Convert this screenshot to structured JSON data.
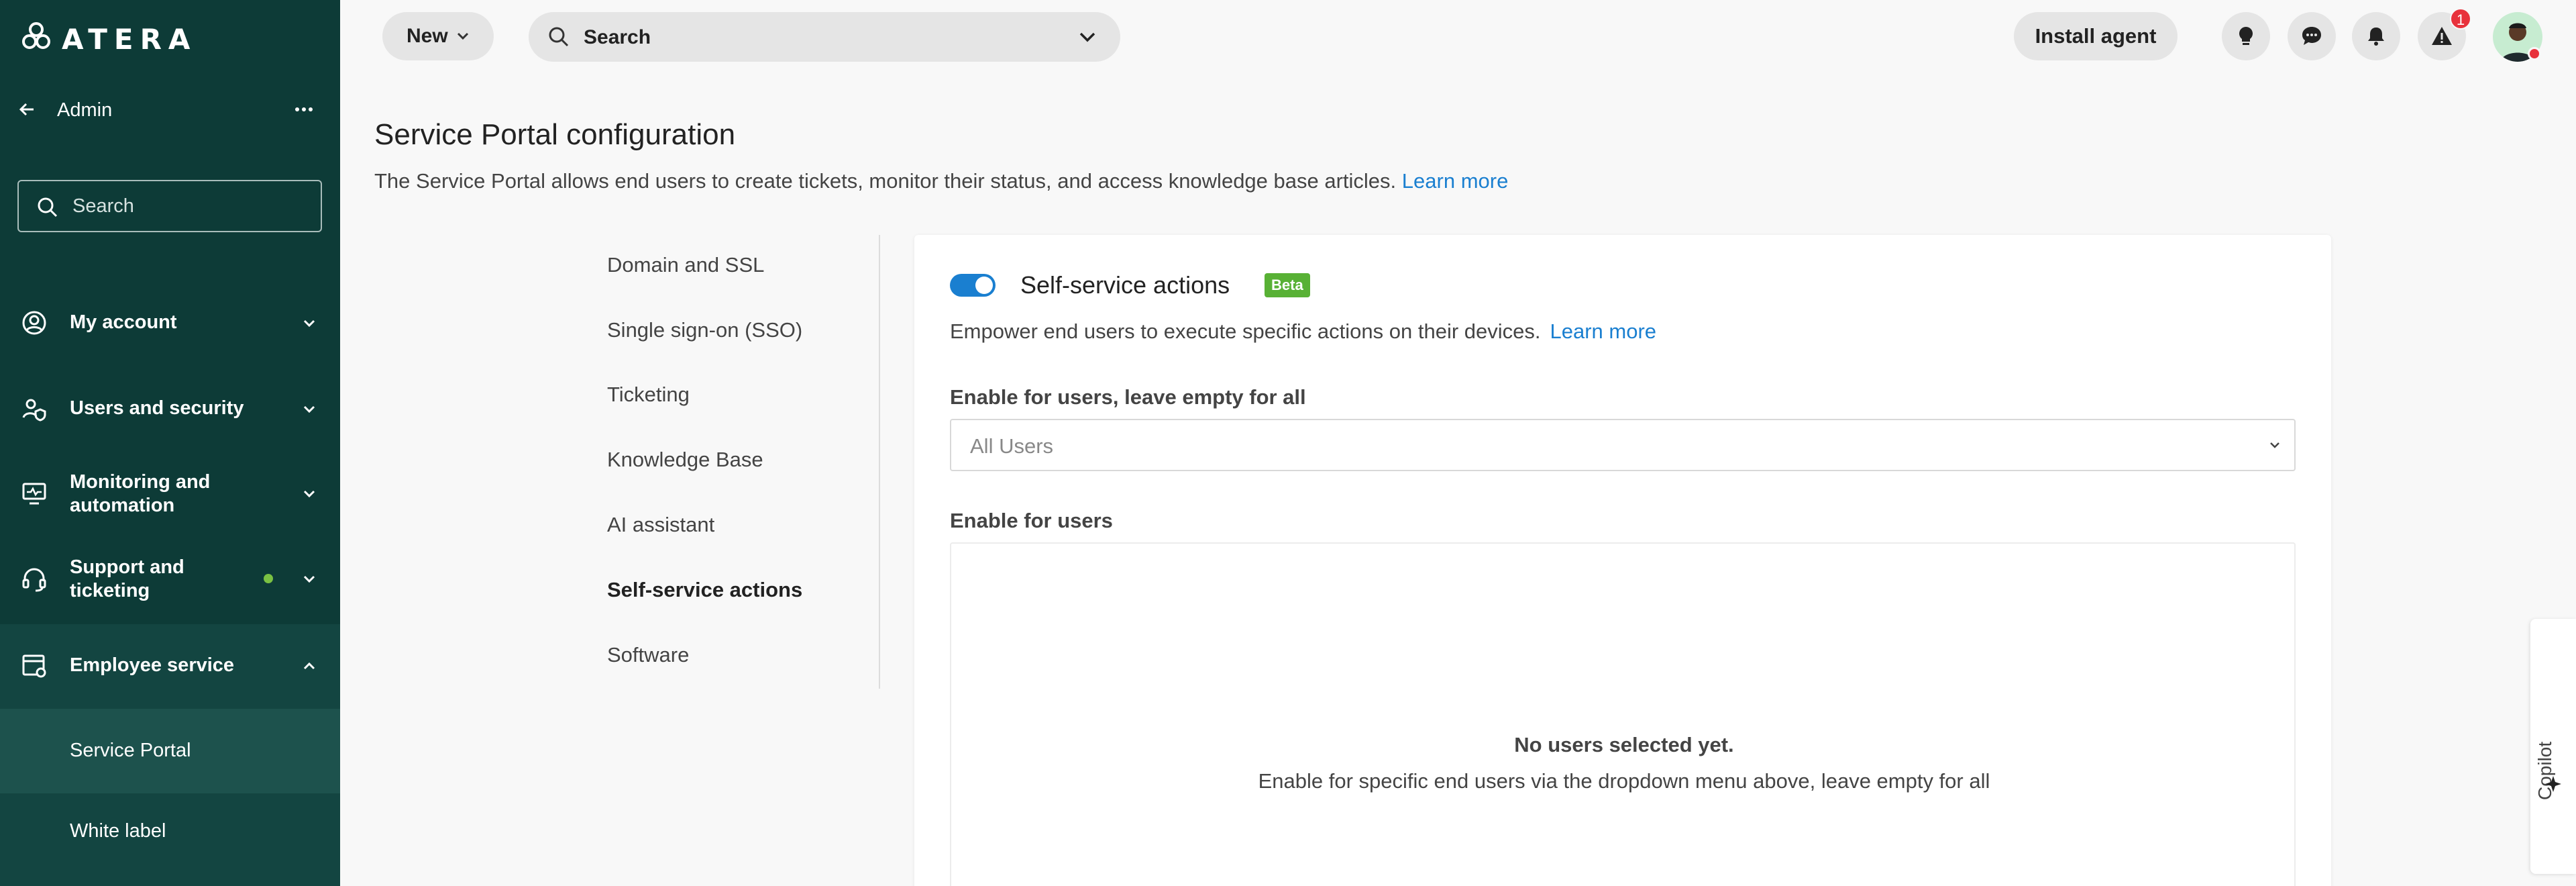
{
  "app": {
    "brand": "ATERA"
  },
  "sidebar": {
    "header_title": "Admin",
    "search_placeholder": "Search",
    "items": [
      {
        "label": "My account",
        "icon": "user-circle-icon"
      },
      {
        "label": "Users and security",
        "icon": "users-shield-icon"
      },
      {
        "label": "Monitoring and automation",
        "icon": "monitor-pulse-icon"
      },
      {
        "label": "Support and ticketing",
        "icon": "headset-icon",
        "status_dot_color": "#7ac143"
      },
      {
        "label": "Employee service",
        "icon": "portal-icon",
        "expanded": true
      }
    ],
    "sub_items": [
      {
        "label": "Service Portal",
        "active": true
      },
      {
        "label": "White label",
        "active": false
      }
    ]
  },
  "topbar": {
    "new_label": "New",
    "search_placeholder": "Search",
    "install_label": "Install agent",
    "icons": [
      "lightbulb-icon",
      "chat-icon",
      "bell-icon",
      "alert-icon"
    ],
    "alert_count": "1"
  },
  "page": {
    "title": "Service Portal configuration",
    "description": "The Service Portal allows end users to create tickets, monitor their status, and access knowledge base articles.",
    "learn_more": "Learn more"
  },
  "menu": {
    "items": [
      {
        "label": "Domain and SSL"
      },
      {
        "label": "Single sign-on (SSO)"
      },
      {
        "label": "Ticketing"
      },
      {
        "label": "Knowledge Base"
      },
      {
        "label": "AI assistant"
      },
      {
        "label": "Self-service actions",
        "active": true
      },
      {
        "label": "Software"
      }
    ]
  },
  "card": {
    "toggle_on": true,
    "title": "Self-service actions",
    "badge": "Beta",
    "description": "Empower end users to execute specific actions on their devices.",
    "learn_more": "Learn more",
    "field1_label": "Enable for users, leave empty for all",
    "select_value": "All Users",
    "field2_label": "Enable for users",
    "empty_title": "No users selected yet.",
    "empty_desc": "Enable for specific end users via the dropdown menu above, leave empty for all"
  },
  "copilot": {
    "label": "Copilot"
  },
  "colors": {
    "sidebar": "#0d3b37",
    "accent": "#1a7fd0",
    "beta": "#58b135",
    "alert": "#e8323c"
  }
}
